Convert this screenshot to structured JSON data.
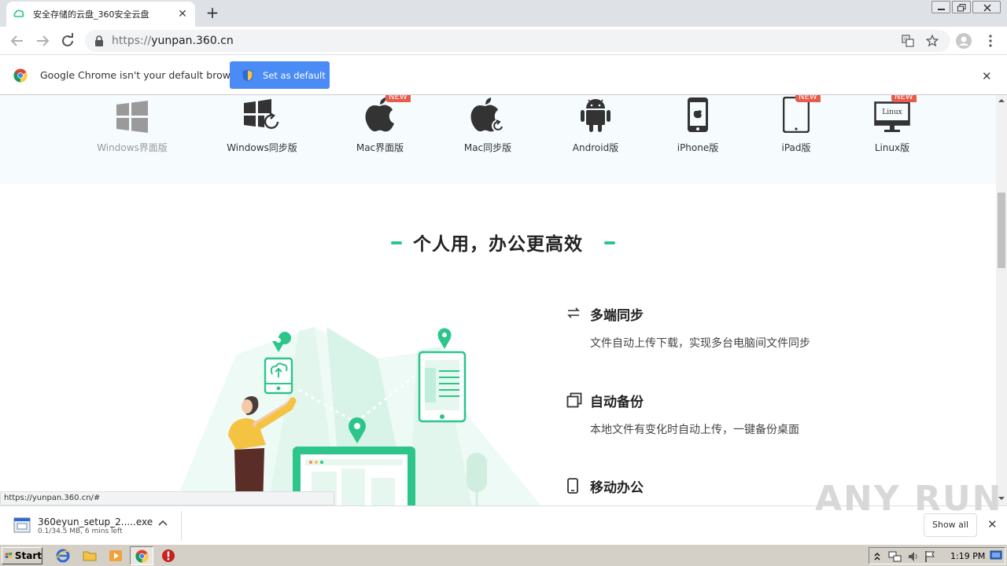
{
  "browser": {
    "tab_title": "安全存储的云盘_360安全云盘",
    "url_scheme": "https://",
    "url_host": "yunpan.360.cn"
  },
  "infobar": {
    "message": "Google Chrome isn't your default browser",
    "button_label": "Set as default"
  },
  "platforms": [
    {
      "label": "Windows界面版",
      "new": false
    },
    {
      "label": "Windows同步版",
      "new": false
    },
    {
      "label": "Mac界面版",
      "new": true
    },
    {
      "label": "Mac同步版",
      "new": false
    },
    {
      "label": "Android版",
      "new": false
    },
    {
      "label": "iPhone版",
      "new": false
    },
    {
      "label": "iPad版",
      "new": true
    },
    {
      "label": "Linux版",
      "new": true
    }
  ],
  "badge_text": "NEW",
  "linux_icon_text": "Linux",
  "section": {
    "title": "个人用，办公更高效"
  },
  "features": [
    {
      "title": "多端同步",
      "desc": "文件自动上传下载，实现多台电脑间文件同步"
    },
    {
      "title": "自动备份",
      "desc": "本地文件有变化时自动上传，一键备份桌面"
    },
    {
      "title": "移动办公",
      "desc": ""
    }
  ],
  "status_url": "https://yunpan.360.cn/#",
  "download": {
    "filename": "360eyun_setup_2.....exe",
    "status": "0.1/34.5 MB, 6 mins left",
    "show_all": "Show all"
  },
  "watermark": "ANY RUN",
  "taskbar": {
    "start_label": "Start",
    "clock": "1:19 PM"
  },
  "colors": {
    "accent_green": "#2cc58a",
    "chrome_blue": "#4a8bf5",
    "new_badge": "#e95b4b"
  }
}
